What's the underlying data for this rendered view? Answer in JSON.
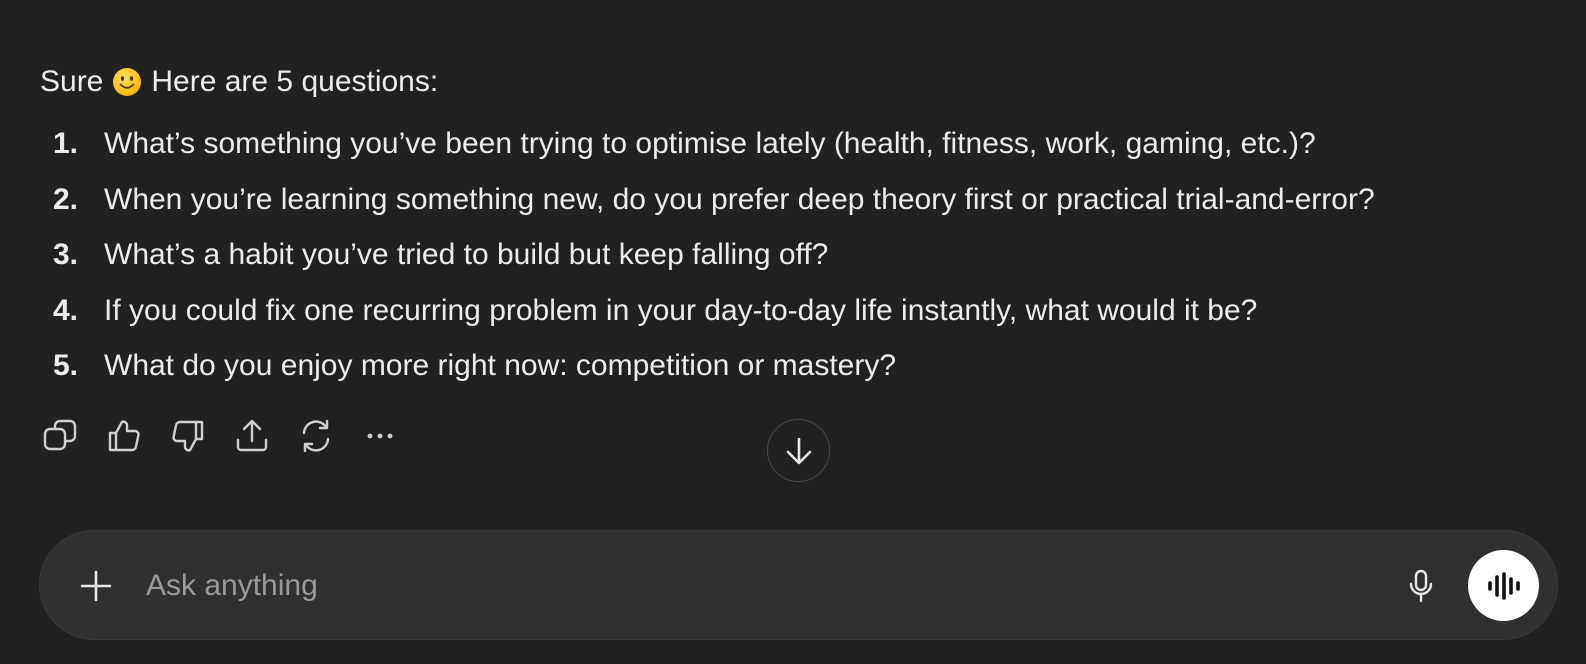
{
  "message": {
    "intro_before": "Sure",
    "intro_emoji": "slightly-smiling-face",
    "intro_after": "Here are 5 questions:",
    "questions": [
      {
        "number": "1.",
        "text": "What’s something you’ve been trying to optimise lately (health, fitness, work, gaming, etc.)?"
      },
      {
        "number": "2.",
        "text": "When you’re learning something new, do you prefer deep theory first or practical trial-and-error?"
      },
      {
        "number": "3.",
        "text": "What’s a habit you’ve tried to build but keep falling off?"
      },
      {
        "number": "4.",
        "text": "If you could fix one recurring problem in your day-to-day life instantly, what would it be?"
      },
      {
        "number": "5.",
        "text": "What do you enjoy more right now: competition or mastery?"
      }
    ]
  },
  "actions": [
    "copy-icon",
    "thumbs-up-icon",
    "thumbs-down-icon",
    "share-icon",
    "regenerate-icon",
    "more-icon"
  ],
  "composer": {
    "placeholder": "Ask anything"
  },
  "colors": {
    "background": "#212121",
    "composer": "#303030",
    "text": "#ececec",
    "placeholder": "#9b9b9b",
    "voice_button": "#ffffff"
  }
}
